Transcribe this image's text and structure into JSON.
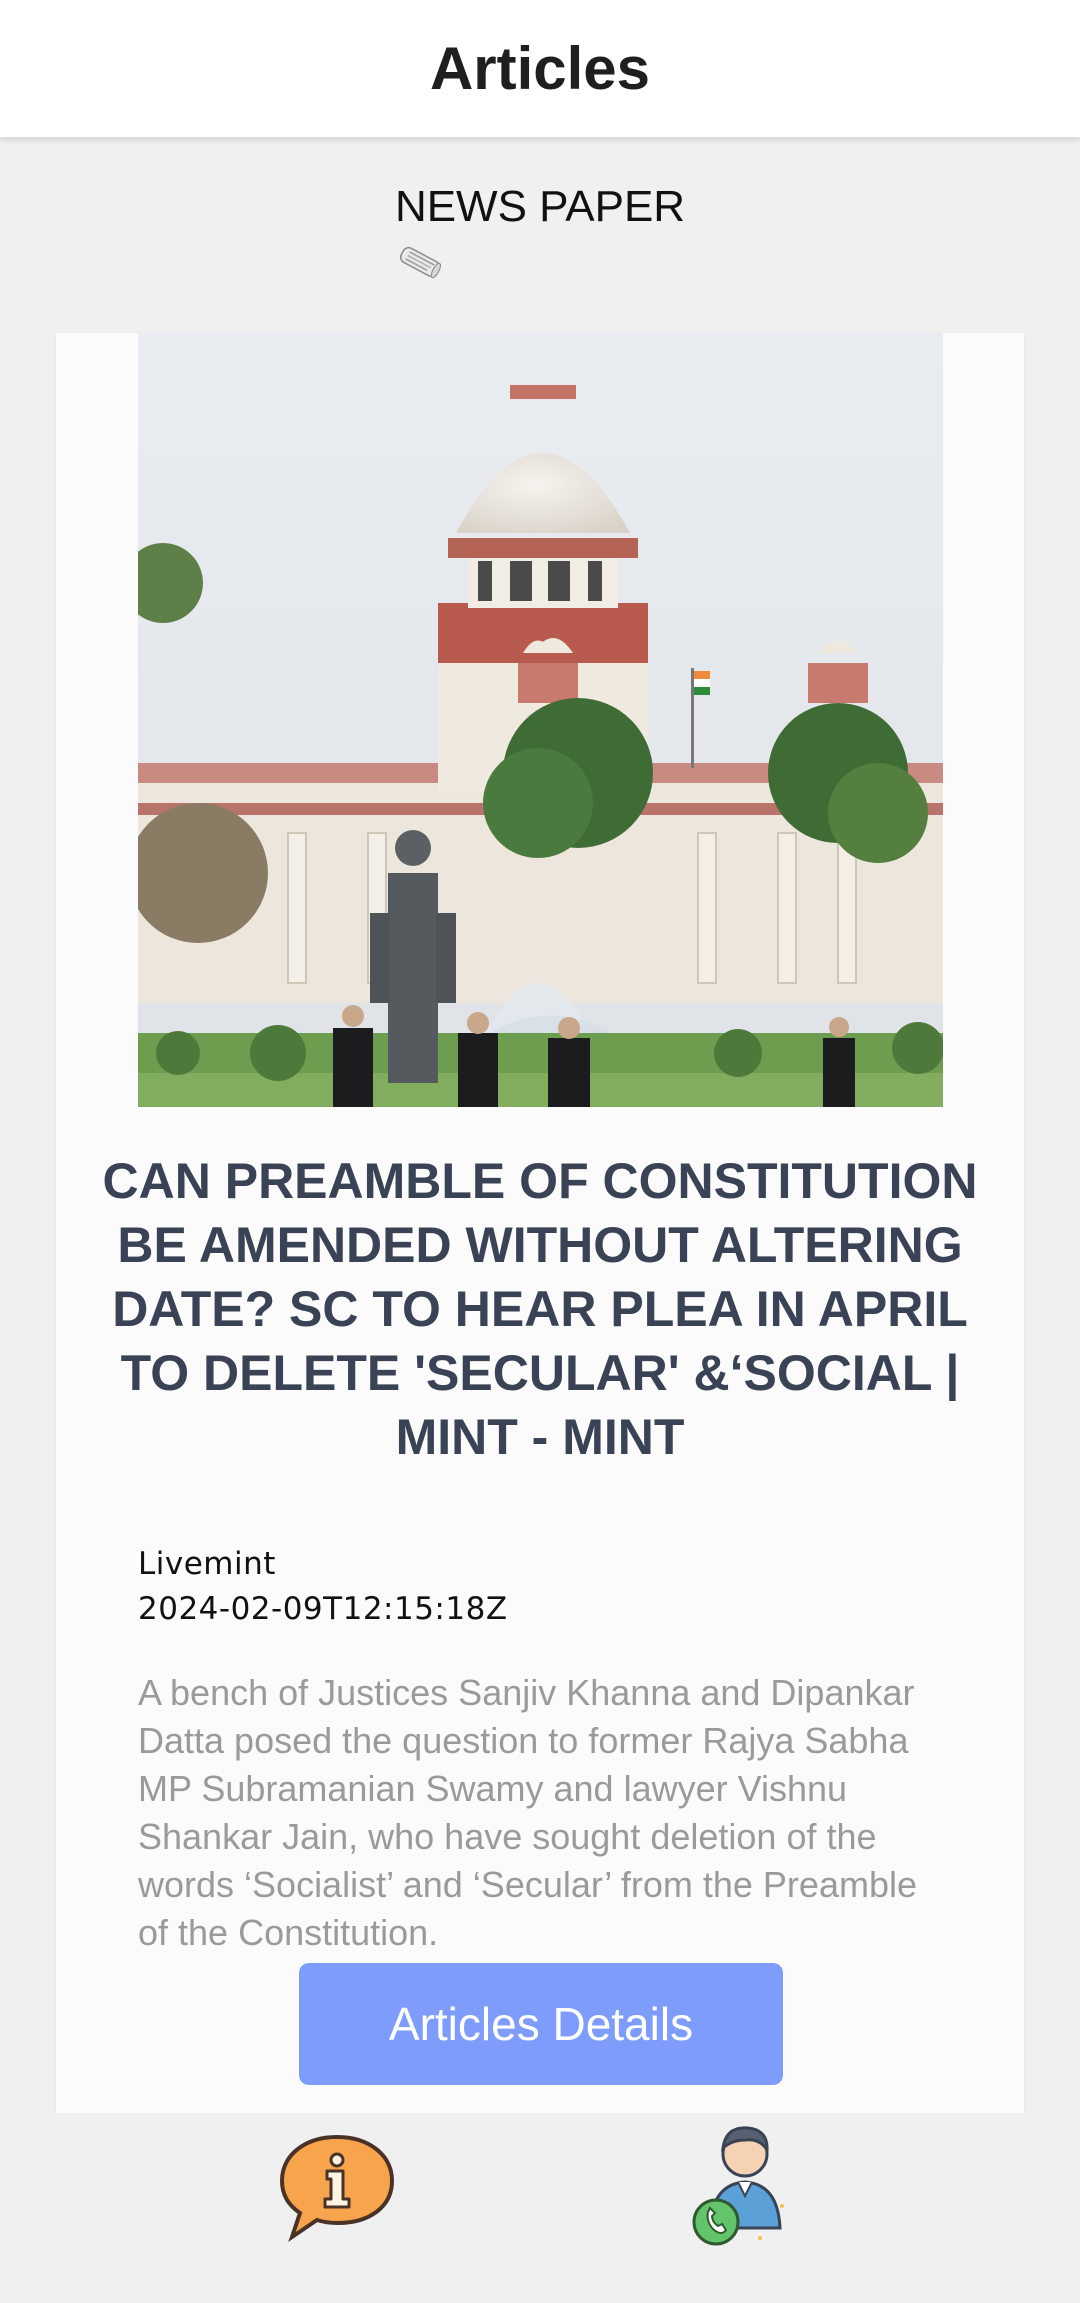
{
  "app_bar": {
    "title": "Articles"
  },
  "section": {
    "title": "NEWS PAPER",
    "icon": "newspaper-icon"
  },
  "article": {
    "image": "supreme-court-building-photo",
    "title": "CAN PREAMBLE OF CONSTITUTION BE AMENDED WITHOUT ALTERING DATE? SC TO HEAR PLEA IN APRIL TO DELETE 'SECULAR' &‘SOCIAL | MINT - MINT",
    "source": "Livemint",
    "published_at": "2024-02-09T12:15:18Z",
    "description": "A bench of Justices Sanjiv Khanna and Dipankar Datta posed the question to former Rajya Sabha MP Subramanian Swamy and lawyer Vishnu Shankar Jain, who have sought deletion of the words ‘Socialist’ and ‘Secular’ from the Preamble of the Constitution.",
    "button_label": "Articles Details"
  },
  "bottom_nav": {
    "items": [
      {
        "icon": "info-speech-bubble-icon"
      },
      {
        "icon": "contact-support-icon"
      }
    ]
  },
  "colors": {
    "button": "#7e9cfb",
    "headline": "#3a4356",
    "description": "#9a9a9a",
    "background": "#f0f0f0"
  }
}
